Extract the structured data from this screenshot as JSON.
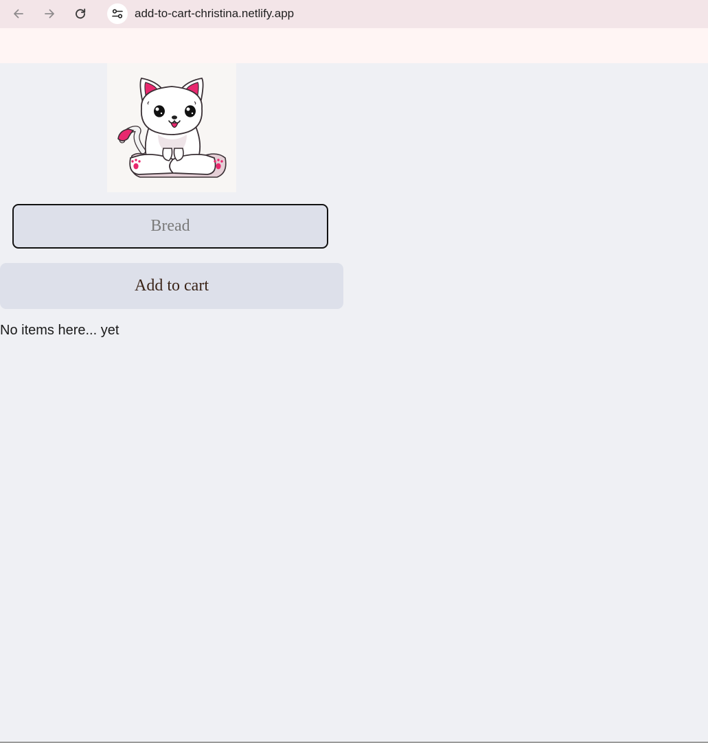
{
  "browser": {
    "url": "add-to-cart-christina.netlify.app",
    "icons": {
      "back": "arrow-left-icon",
      "forward": "arrow-right-icon",
      "reload": "reload-icon",
      "site_info": "tune-icon"
    }
  },
  "app": {
    "image_alt": "cat illustration",
    "input": {
      "value": "",
      "placeholder": "Bread"
    },
    "add_button_label": "Add to cart",
    "empty_message": "No items here... yet"
  },
  "colors": {
    "page_bg": "#eff0f4",
    "control_bg": "#dde0ea",
    "cat_accent": "#e8286e",
    "chrome_bg": "#fff5f4",
    "toolbar_bg": "#f3e5e8"
  }
}
